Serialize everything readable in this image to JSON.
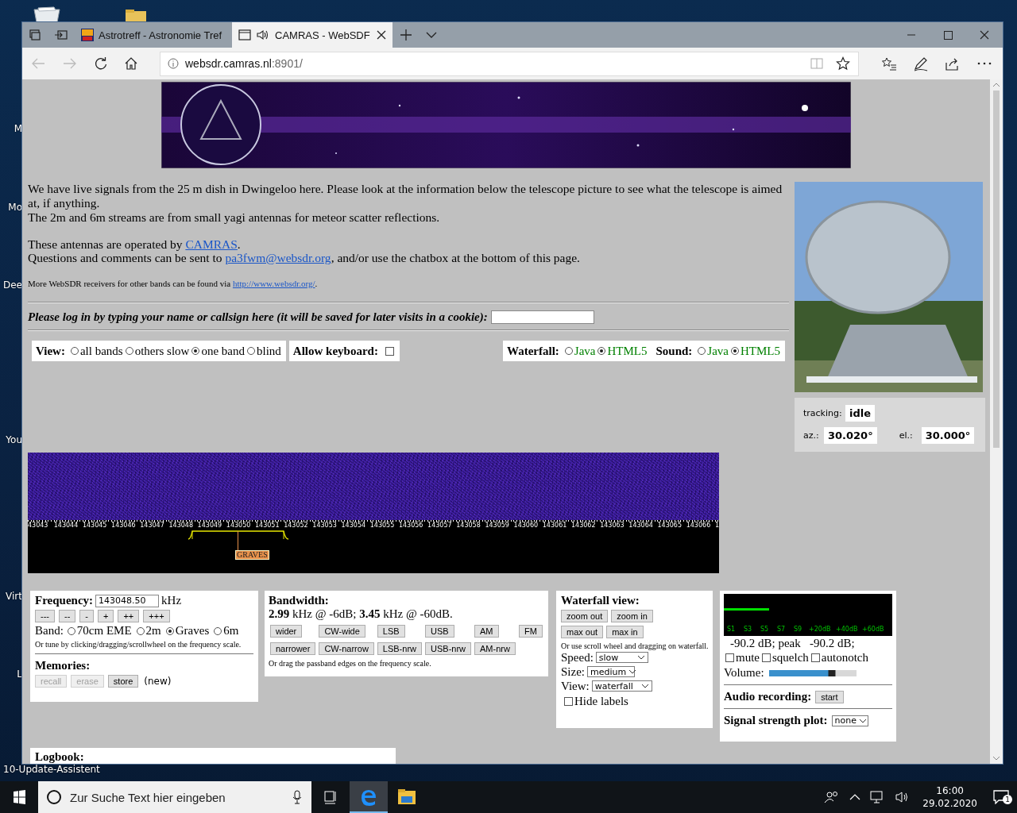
{
  "desktop": {
    "labels": [
      "M",
      "Mo",
      "Dee",
      "You",
      "Virt",
      "L",
      "10-Update-Assistent"
    ]
  },
  "browser": {
    "tabs": [
      {
        "title": "Astrotreff - Astronomie Tref",
        "selected": false,
        "audio": false
      },
      {
        "title": "CAMRAS - WebSDF",
        "selected": true,
        "audio": true
      }
    ],
    "address": {
      "host": "websdr.camras.nl",
      "rest": ":8901/"
    }
  },
  "page": {
    "intro": [
      "We have live signals from the 25 m dish in Dwingeloo here. Please look at the information below the telescope picture to see what the telescope is aimed at, if anything.",
      "The 2m and 6m streams are from small yagi antennas for meteor scatter reflections."
    ],
    "contact": [
      {
        "before": "These antennas are operated by ",
        "link": "CAMRAS",
        "after": "."
      },
      {
        "before": "Questions and comments can be sent to ",
        "link": "pa3fwm@websdr.org",
        "after": ", and/or use the chatbox at the bottom of this page."
      }
    ],
    "more": {
      "before": "More WebSDR receivers for other bands can be found via ",
      "link": "http://www.websdr.org/",
      "after": "."
    },
    "login": {
      "label": "Please log in by typing your name or callsign here (it will be saved for later visits in a cookie):"
    },
    "view": {
      "label": "View:",
      "options": [
        {
          "label": "all bands",
          "selected": false
        },
        {
          "label": "others slow",
          "selected": false
        },
        {
          "label": "one band",
          "selected": true
        },
        {
          "label": "blind",
          "selected": false
        }
      ]
    },
    "keyboard": {
      "label": "Allow keyboard:",
      "checked": false
    },
    "engines": [
      {
        "label": "Waterfall:",
        "options": [
          {
            "label": "Java",
            "selected": false
          },
          {
            "label": "HTML5",
            "selected": true
          }
        ]
      },
      {
        "label": "Sound:",
        "options": [
          {
            "label": "Java",
            "selected": false
          },
          {
            "label": "HTML5",
            "selected": true
          }
        ]
      }
    ],
    "tracking": {
      "label": "tracking:",
      "value": "idle",
      "az_label": "az.:",
      "az": "30.020°",
      "el_label": "el.:",
      "el": "30.000°"
    },
    "waterfall": {
      "scale": [
        "43043",
        "143044",
        "143045",
        "143046",
        "143047",
        "143048",
        "143049",
        "143050",
        "143051",
        "143052",
        "143053",
        "143054",
        "143055",
        "143056",
        "143057",
        "143058",
        "143059",
        "143060",
        "143061",
        "143062",
        "143063",
        "143064",
        "143065",
        "143066",
        "1"
      ],
      "marker": "GRAVES"
    },
    "frequency": {
      "label": "Frequency:",
      "value": "143048.50",
      "unit": "kHz",
      "steps": [
        "---",
        "--",
        "-",
        "+",
        "++",
        "+++"
      ],
      "band_label": "Band:",
      "bands": [
        {
          "label": "70cm EME",
          "selected": false
        },
        {
          "label": "2m",
          "selected": false
        },
        {
          "label": "Graves",
          "selected": true
        },
        {
          "label": "6m",
          "selected": false
        }
      ],
      "hint": "Or tune by clicking/dragging/scrollwheel on the frequency scale.",
      "memories": {
        "label": "Memories:",
        "buttons": [
          {
            "label": "recall",
            "disabled": true
          },
          {
            "label": "erase",
            "disabled": true
          },
          {
            "label": "store",
            "disabled": false
          }
        ],
        "status": "(new)"
      }
    },
    "bandwidth": {
      "label": "Bandwidth:",
      "value": "**2.99** kHz @ -6dB; **3.45** kHz @ -60dB.",
      "rows": [
        [
          "wider",
          "CW-wide",
          "LSB",
          "USB",
          "AM",
          "FM"
        ],
        [
          "narrower",
          "CW-narrow",
          "LSB-nrw",
          "USB-nrw",
          "AM-nrw"
        ]
      ],
      "hint": "Or drag the passband edges on the frequency scale."
    },
    "waterfall_view": {
      "label": "Waterfall view:",
      "rows": [
        [
          "zoom out",
          "zoom in"
        ],
        [
          "max out",
          "max in"
        ]
      ],
      "hint": "Or use scroll wheel and dragging on waterfall.",
      "selects": [
        {
          "label": "Speed:",
          "value": "slow"
        },
        {
          "label": "Size:",
          "value": "medium"
        },
        {
          "label": "View:",
          "value": "waterfall"
        }
      ],
      "hide_labels": {
        "label": "Hide labels",
        "checked": false
      }
    },
    "audio": {
      "smeter": {
        "level": 0.27,
        "labels": [
          "S1",
          "S3",
          "S5",
          "S7",
          "S9",
          "+20dB",
          "+40dB",
          "+60dB"
        ]
      },
      "reading": "-90.2 dB; peak   -90.2 dB;",
      "toggles": [
        {
          "label": "mute",
          "checked": false
        },
        {
          "label": "squelch",
          "checked": false
        },
        {
          "label": "autonotch",
          "checked": false
        }
      ],
      "volume": {
        "label": "Volume:",
        "level": 0.72
      },
      "recording": {
        "label": "Audio recording:",
        "button": "start"
      },
      "plot": {
        "label": "Signal strength plot:",
        "value": "none"
      }
    },
    "logbook": {
      "label": "Logbook:"
    }
  },
  "taskbar": {
    "search_placeholder": "Zur Suche Text hier eingeben",
    "apps": [
      {
        "kind": "browser",
        "selected": true
      },
      {
        "kind": "folder",
        "selected": false
      }
    ],
    "time": "16:00",
    "date": "29.02.2020",
    "notifications": "1"
  }
}
